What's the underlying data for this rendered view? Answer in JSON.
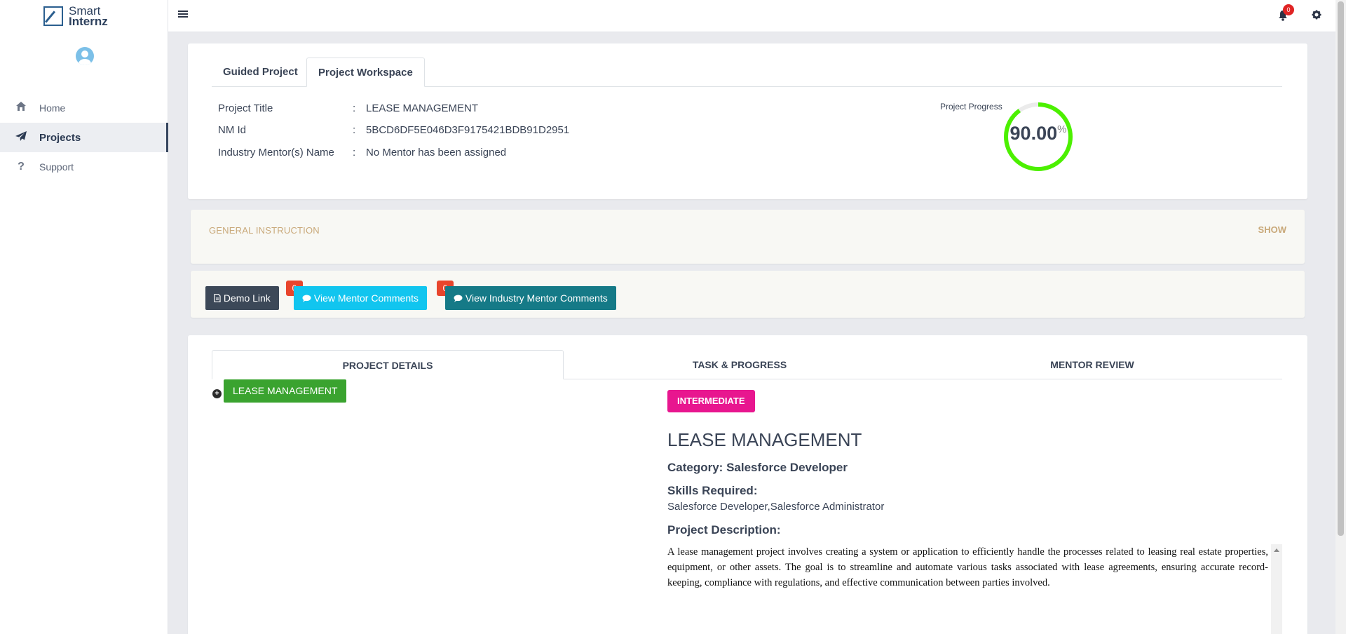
{
  "brand": {
    "line1": "Smart",
    "line2": "Internz"
  },
  "sidebar": {
    "items": [
      {
        "label": "Home",
        "icon": "home-icon"
      },
      {
        "label": "Projects",
        "icon": "paper-plane-icon"
      },
      {
        "label": "Support",
        "icon": "question-icon"
      }
    ]
  },
  "topbar": {
    "notifications_count": "0"
  },
  "workspace_tabs": [
    "Guided Project",
    "Project Workspace"
  ],
  "info": {
    "title_label": "Project Title",
    "title_value": "LEASE MANAGEMENT",
    "nmid_label": "NM Id",
    "nmid_value": "5BCD6DF5E046D3F9175421BDB91D2951",
    "mentor_label": "Industry Mentor(s) Name",
    "mentor_value": "No Mentor has been assigned",
    "separator": ":"
  },
  "progress": {
    "label": "Project Progress",
    "value": "90.00",
    "unit": "%",
    "fraction": 0.9,
    "color": "#4cf000"
  },
  "general_instruction": {
    "title": "GENERAL INSTRUCTION",
    "toggle": "SHOW"
  },
  "actions": {
    "demo_label": "Demo Link",
    "mentor_label": "View Mentor Comments",
    "mentor_count": "0",
    "industry_label": "View Industry Mentor Comments",
    "industry_count": "0"
  },
  "detail_tabs": [
    "PROJECT DETAILS",
    "TASK & PROGRESS",
    "MENTOR REVIEW"
  ],
  "details": {
    "tree_button": "LEASE MANAGEMENT",
    "level": "INTERMEDIATE",
    "title": "LEASE MANAGEMENT",
    "category": "Category: Salesforce Developer",
    "skills_heading": "Skills Required:",
    "skills": "Salesforce Developer,Salesforce Administrator",
    "description_heading": "Project Description:",
    "description": "A lease management project involves creating a system or application to efficiently handle the processes related to leasing real estate properties, equipment, or other assets. The goal is to streamline and automate various tasks associated with lease agreements, ensuring accurate record-keeping, compliance with regulations, and effective communication between parties involved."
  },
  "colors": {
    "accent_green": "#3aa32f",
    "badge_pink": "#e8168f",
    "cyan": "#11c5ef",
    "teal": "#157a87",
    "dark": "#3c4858"
  }
}
